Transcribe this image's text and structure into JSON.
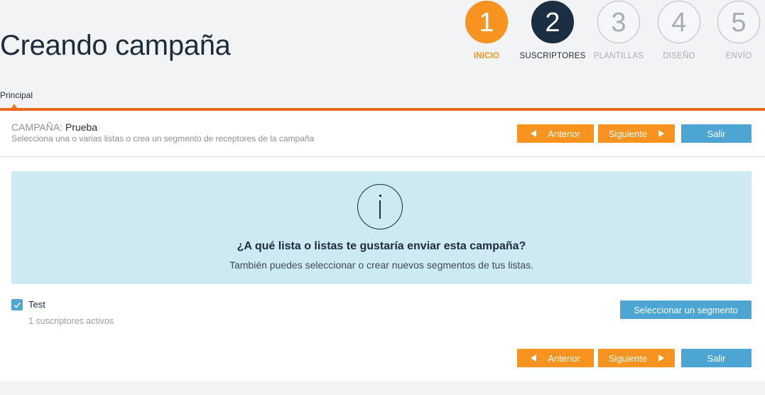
{
  "page": {
    "title": "Creando campaña"
  },
  "steps": [
    {
      "number": "1",
      "label": "INICIO"
    },
    {
      "number": "2",
      "label": "SUSCRIPTORES"
    },
    {
      "number": "3",
      "label": "PLANTILLAS"
    },
    {
      "number": "4",
      "label": "DISEÑO"
    },
    {
      "number": "5",
      "label": "ENVÍO"
    }
  ],
  "tabs": {
    "main": "Principal"
  },
  "campaign": {
    "key": "CAMPAÑA:",
    "name": "Prueba",
    "description": "Selecciona una o varias listas o crea un segmento de receptores de la campaña"
  },
  "nav": {
    "previous": "Anterior",
    "next": "Siguiente",
    "exit": "Salir"
  },
  "info": {
    "title": "¿A qué lista o listas te gustaría enviar esta campaña?",
    "subtitle": "También puedes seleccionar o crear nuevos segmentos de tus listas."
  },
  "lists": [
    {
      "name": "Test",
      "count": "1 suscriptores activos",
      "checked": true
    }
  ],
  "segment_button": "Seleccionar un segmento",
  "colors": {
    "accent_orange": "#f7931e",
    "progress_bar": "#e8681c",
    "button_blue": "#4da5d4",
    "current_step": "#1b2e42",
    "info_bg": "#cdeaf3"
  }
}
